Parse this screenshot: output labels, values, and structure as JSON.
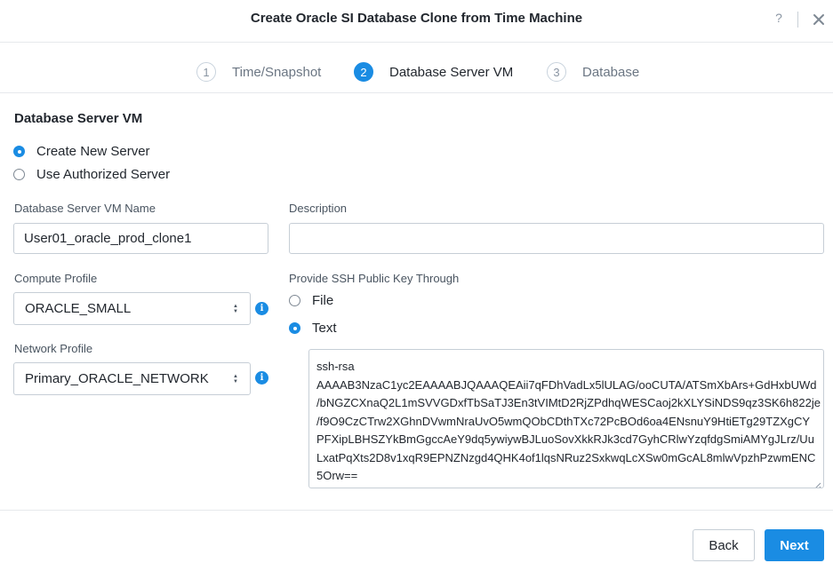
{
  "dialog": {
    "title": "Create Oracle SI Database Clone from Time Machine",
    "help_label": "?"
  },
  "steps": [
    {
      "number": "1",
      "label": "Time/Snapshot",
      "state": "inactive"
    },
    {
      "number": "2",
      "label": "Database Server VM",
      "state": "active"
    },
    {
      "number": "3",
      "label": "Database",
      "state": "inactive"
    }
  ],
  "section": {
    "title": "Database Server VM"
  },
  "server_choice": {
    "create_new": "Create New Server",
    "use_authorized": "Use Authorized Server",
    "selected": "create_new"
  },
  "vm_name": {
    "label": "Database Server VM Name",
    "value": "User01_oracle_prod_clone1"
  },
  "description": {
    "label": "Description",
    "value": ""
  },
  "compute_profile": {
    "label": "Compute Profile",
    "value": "ORACLE_SMALL"
  },
  "network_profile": {
    "label": "Network Profile",
    "value": "Primary_ORACLE_NETWORK"
  },
  "ssh": {
    "label": "Provide SSH Public Key Through",
    "option_file": "File",
    "option_text": "Text",
    "selected": "text",
    "key_lines": [
      "ssh-rsa",
      "AAAAB3NzaC1yc2EAAAABJQAAAQEAii7qFDhVadLx5lULAG/ooCUTA/ATSmXbArs+GdHxbUWd",
      "/bNGZCXnaQ2L1mSVVGDxfTbSaTJ3En3tVIMtD2RjZPdhqWESCaoj2kXLYSiNDS9qz3SK6h822je",
      "/f9O9CzCTrw2XGhnDVwmNraUvO5wmQObCDthTXc72PcBOd6oa4ENsnuY9HtiETg29TZXgCY",
      "PFXipLBHSZYkBmGgccAeY9dq5ywiywBJLuoSovXkkRJk3cd7GyhCRlwYzqfdgSmiAMYgJLrz/Uu",
      "LxatPqXts2D8v1xqR9EPNZNzgd4QHK4of1lqsNRuz2SxkwqLcXSw0mGcAL8mlwVpzhPzwmENC",
      "5Orw=="
    ]
  },
  "icons": {
    "close": "close-icon",
    "info": "info-icon",
    "select_arrows": "chevron-updown-icon",
    "resize": "resize-grip-icon"
  },
  "colors": {
    "accent": "#1a8ce3",
    "text": "#22272e",
    "border": "#c6ced6"
  },
  "footer": {
    "back_label": "Back",
    "next_label": "Next"
  }
}
